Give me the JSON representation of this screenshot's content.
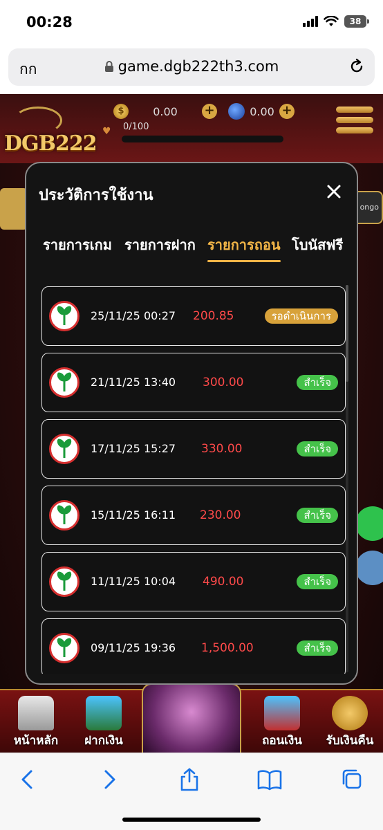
{
  "status_bar": {
    "time": "00:28",
    "battery": "38"
  },
  "browser": {
    "aa_label": "กก",
    "url": "game.dgb222th3.com"
  },
  "game": {
    "logo": "DGB222",
    "coin_balance": "0.00",
    "gem_balance": "0.00",
    "level_progress": "0/100",
    "side_right_label": "ongo"
  },
  "modal": {
    "title": "ประวัติการใช้งาน",
    "tabs": [
      {
        "label": "รายการเกม",
        "active": false
      },
      {
        "label": "รายการฝาก",
        "active": false
      },
      {
        "label": "รายการถอน",
        "active": true
      },
      {
        "label": "โบนัสฟรี",
        "active": false
      }
    ],
    "rows": [
      {
        "date": "25/11/25 00:27",
        "amount": "200.85",
        "status": "รอดำเนินการ",
        "status_type": "pending"
      },
      {
        "date": "21/11/25 13:40",
        "amount": "300.00",
        "status": "สำเร็จ",
        "status_type": "success"
      },
      {
        "date": "17/11/25 15:27",
        "amount": "330.00",
        "status": "สำเร็จ",
        "status_type": "success"
      },
      {
        "date": "15/11/25 16:11",
        "amount": "230.00",
        "status": "สำเร็จ",
        "status_type": "success"
      },
      {
        "date": "11/11/25 10:04",
        "amount": "490.00",
        "status": "สำเร็จ",
        "status_type": "success"
      },
      {
        "date": "09/11/25 19:36",
        "amount": "1,500.00",
        "status": "สำเร็จ",
        "status_type": "success"
      }
    ]
  },
  "game_nav": {
    "items": [
      {
        "label": "หน้าหลัก",
        "icon": "house-icon"
      },
      {
        "label": "ฝากเงิน",
        "icon": "deposit-icon"
      },
      {
        "label": "ถอนเงิน",
        "icon": "withdraw-icon"
      },
      {
        "label": "รับเงินคืน",
        "icon": "cashback-icon"
      }
    ]
  },
  "colors": {
    "accent": "#f2b547",
    "amount": "#ff4a4a",
    "success": "#45c24a",
    "pending": "#d8a23a",
    "ios_blue": "#1a73e8"
  }
}
